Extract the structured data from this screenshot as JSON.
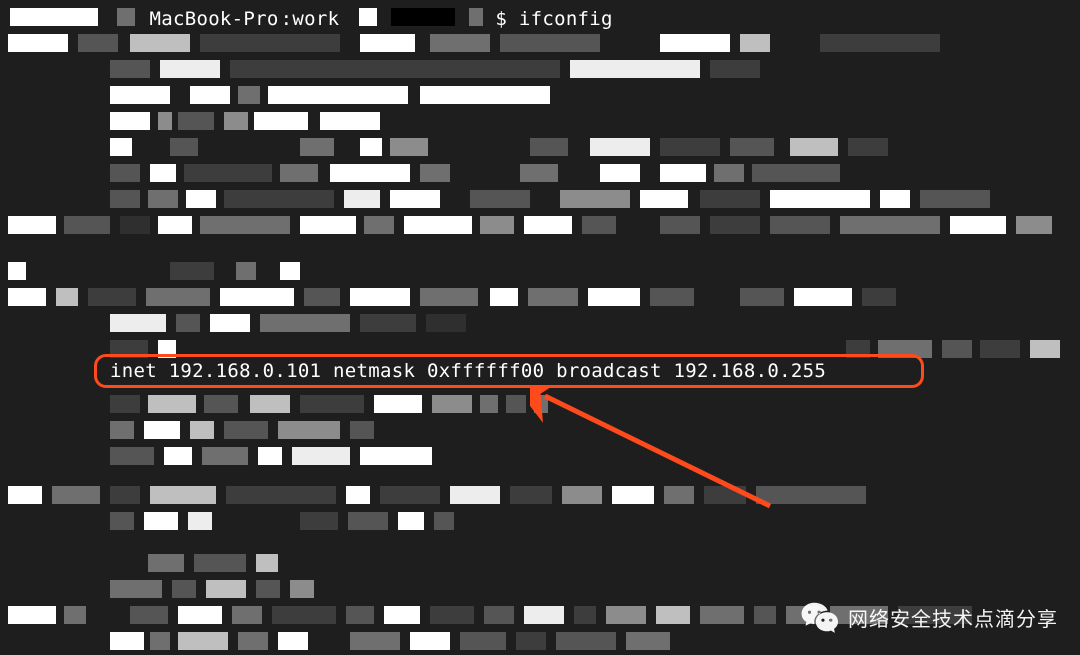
{
  "terminal": {
    "hostname_visible": "MacBook-Pro",
    "prompt_path": "work",
    "command": "ifconfig"
  },
  "highlighted_line": "inet 192.168.0.101 netmask 0xffffff00 broadcast 192.168.0.255",
  "watermark_text": "网络安全技术点滴分享",
  "annotation_color": "#ff4a1c"
}
